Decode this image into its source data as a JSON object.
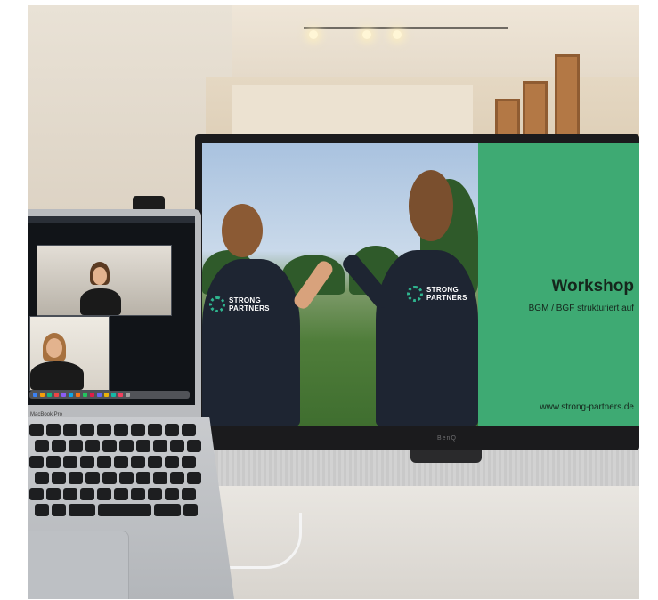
{
  "slide": {
    "title": "Workshop",
    "subtitle": "BGM / BGF strukturiert auf",
    "url": "www.strong-partners.de",
    "shirt_logo_left": "STRONG\nPARTNERS",
    "shirt_logo_right": "STRONG\nPARTNERS",
    "panel_color": "#3eaa73"
  },
  "monitor": {
    "brand": "BenQ"
  },
  "laptop": {
    "label": "MacBook Pro"
  }
}
